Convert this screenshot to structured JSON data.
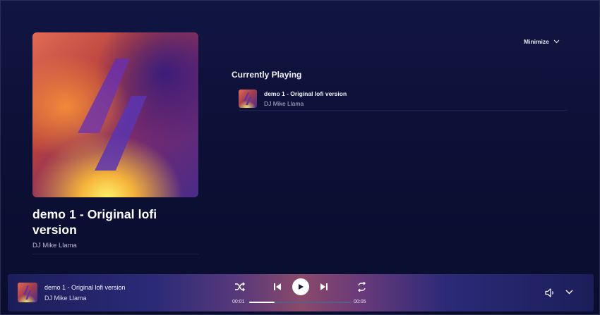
{
  "now_playing": {
    "title": "demo 1 - Original lofi version",
    "artist": "DJ Mike Llama"
  },
  "header": {
    "minimize_label": "Minimize"
  },
  "queue": {
    "section_title": "Currently Playing",
    "items": [
      {
        "title": "demo 1 - Original lofi version",
        "artist": "DJ Mike Llama"
      }
    ]
  },
  "player": {
    "title": "demo 1 - Original lofi version",
    "artist": "DJ Mike Llama",
    "elapsed": "00:01",
    "total": "00:05",
    "progress_fraction": 0.25,
    "icons": {
      "shuffle": "shuffle-icon",
      "previous": "skip-previous-icon",
      "play": "play-icon",
      "next": "skip-next-icon",
      "repeat": "repeat-icon",
      "volume": "volume-icon",
      "expand": "chevron-down-icon"
    }
  },
  "colors": {
    "background": "#0c1033",
    "accent": "#ffffff",
    "muted_text": "#b8bbd4"
  }
}
